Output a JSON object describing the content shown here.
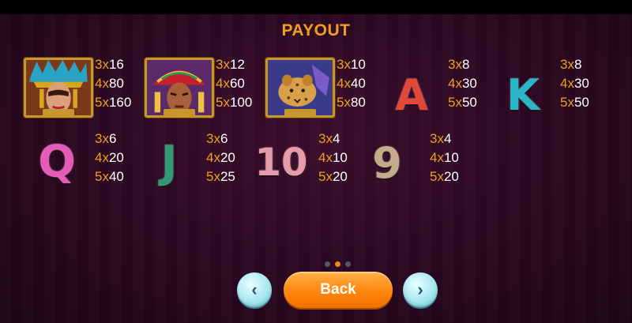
{
  "title": "PAYOUT",
  "colors": {
    "title": "#f0a020",
    "count": "#f0a020",
    "value": "#ffffff",
    "dot_active": "#f08a10",
    "dot_inactive": "#555566"
  },
  "symbols": [
    {
      "name": "aztec-queen",
      "pays": [
        {
          "count": "3x",
          "value": "16"
        },
        {
          "count": "4x",
          "value": "80"
        },
        {
          "count": "5x",
          "value": "160"
        }
      ]
    },
    {
      "name": "aztec-warrior",
      "pays": [
        {
          "count": "3x",
          "value": "12"
        },
        {
          "count": "4x",
          "value": "60"
        },
        {
          "count": "5x",
          "value": "100"
        }
      ]
    },
    {
      "name": "jaguar",
      "pays": [
        {
          "count": "3x",
          "value": "10"
        },
        {
          "count": "4x",
          "value": "40"
        },
        {
          "count": "5x",
          "value": "80"
        }
      ]
    },
    {
      "name": "A",
      "color": "#e2483a",
      "pays": [
        {
          "count": "3x",
          "value": "8"
        },
        {
          "count": "4x",
          "value": "30"
        },
        {
          "count": "5x",
          "value": "50"
        }
      ]
    },
    {
      "name": "K",
      "color": "#2bb6c8",
      "pays": [
        {
          "count": "3x",
          "value": "8"
        },
        {
          "count": "4x",
          "value": "30"
        },
        {
          "count": "5x",
          "value": "50"
        }
      ]
    },
    {
      "name": "Q",
      "color": "#e55bb8",
      "pays": [
        {
          "count": "3x",
          "value": "6"
        },
        {
          "count": "4x",
          "value": "20"
        },
        {
          "count": "5x",
          "value": "40"
        }
      ]
    },
    {
      "name": "J",
      "color": "#2f9a74",
      "pays": [
        {
          "count": "3x",
          "value": "6"
        },
        {
          "count": "4x",
          "value": "20"
        },
        {
          "count": "5x",
          "value": "25"
        }
      ]
    },
    {
      "name": "10",
      "color": "#e79aaa",
      "pays": [
        {
          "count": "3x",
          "value": "4"
        },
        {
          "count": "4x",
          "value": "10"
        },
        {
          "count": "5x",
          "value": "20"
        }
      ]
    },
    {
      "name": "9",
      "color": "#c4ab8c",
      "pays": [
        {
          "count": "3x",
          "value": "4"
        },
        {
          "count": "4x",
          "value": "10"
        },
        {
          "count": "5x",
          "value": "20"
        }
      ]
    }
  ],
  "pagination": {
    "pages": 3,
    "current": 2
  },
  "buttons": {
    "prev_icon": "chevron-left-icon",
    "back_label": "Back",
    "next_icon": "chevron-right-icon"
  }
}
